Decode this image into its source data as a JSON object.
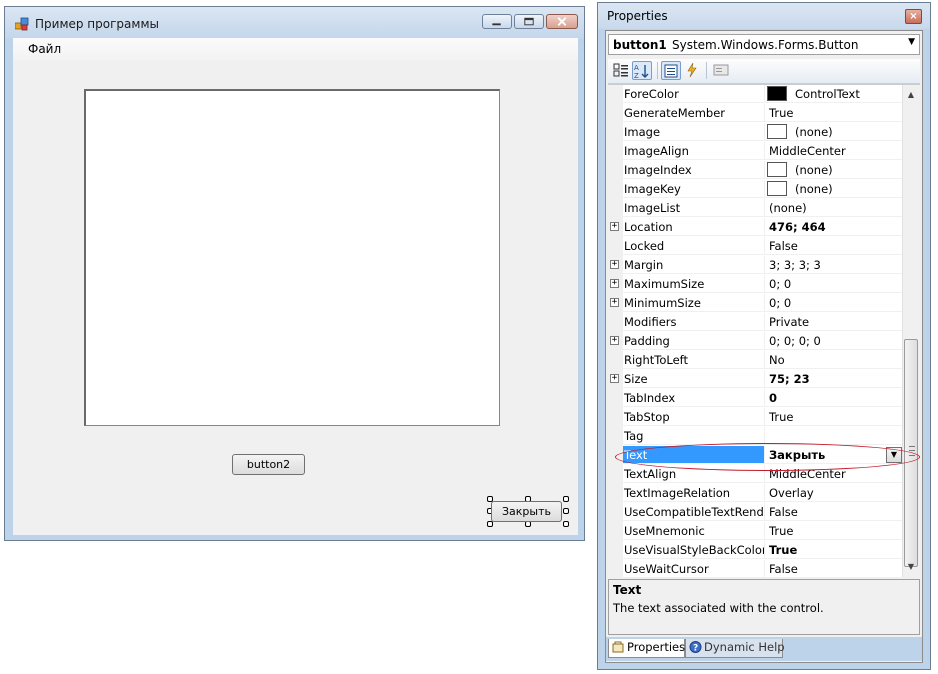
{
  "form_window": {
    "title": "Пример программы",
    "menu": [
      "Файл"
    ],
    "button2_label": "button2",
    "close_button_label": "Закрыть"
  },
  "properties_window": {
    "title": "Properties",
    "close_glyph": "×",
    "object_name": "button1",
    "object_type": "System.Windows.Forms.Button",
    "toolbar_icons": [
      "categorized-icon",
      "alphabetical-icon",
      "properties-icon",
      "events-icon",
      "property-pages-icon"
    ],
    "rows": [
      {
        "name": "ForeColor",
        "value": "ControlText",
        "swatch": "black"
      },
      {
        "name": "GenerateMember",
        "value": "True"
      },
      {
        "name": "Image",
        "value": "(none)",
        "swatch": "white"
      },
      {
        "name": "ImageAlign",
        "value": "MiddleCenter"
      },
      {
        "name": "ImageIndex",
        "value": "(none)",
        "swatch": "white"
      },
      {
        "name": "ImageKey",
        "value": "(none)",
        "swatch": "white"
      },
      {
        "name": "ImageList",
        "value": "(none)"
      },
      {
        "name": "Location",
        "value": "476; 464",
        "expandable": true,
        "bold": true
      },
      {
        "name": "Locked",
        "value": "False"
      },
      {
        "name": "Margin",
        "value": "3; 3; 3; 3",
        "expandable": true
      },
      {
        "name": "MaximumSize",
        "value": "0; 0",
        "expandable": true
      },
      {
        "name": "MinimumSize",
        "value": "0; 0",
        "expandable": true
      },
      {
        "name": "Modifiers",
        "value": "Private"
      },
      {
        "name": "Padding",
        "value": "0; 0; 0; 0",
        "expandable": true
      },
      {
        "name": "RightToLeft",
        "value": "No"
      },
      {
        "name": "Size",
        "value": "75; 23",
        "expandable": true,
        "bold": true
      },
      {
        "name": "TabIndex",
        "value": "0",
        "bold": true
      },
      {
        "name": "TabStop",
        "value": "True"
      },
      {
        "name": "Tag",
        "value": ""
      },
      {
        "name": "Text",
        "value": "Закрыть",
        "selected": true
      },
      {
        "name": "TextAlign",
        "value": "MiddleCenter"
      },
      {
        "name": "TextImageRelation",
        "value": "Overlay"
      },
      {
        "name": "UseCompatibleTextRendering",
        "value": "False"
      },
      {
        "name": "UseMnemonic",
        "value": "True"
      },
      {
        "name": "UseVisualStyleBackColor",
        "value": "True",
        "bold": true
      },
      {
        "name": "UseWaitCursor",
        "value": "False"
      }
    ],
    "description": {
      "title": "Text",
      "text": "The text associated with the control."
    },
    "tabs": [
      "Properties",
      "Dynamic Help"
    ],
    "active_tab": "Properties",
    "accent_color": "#3399ff",
    "annotation_color": "#c21a2a"
  }
}
